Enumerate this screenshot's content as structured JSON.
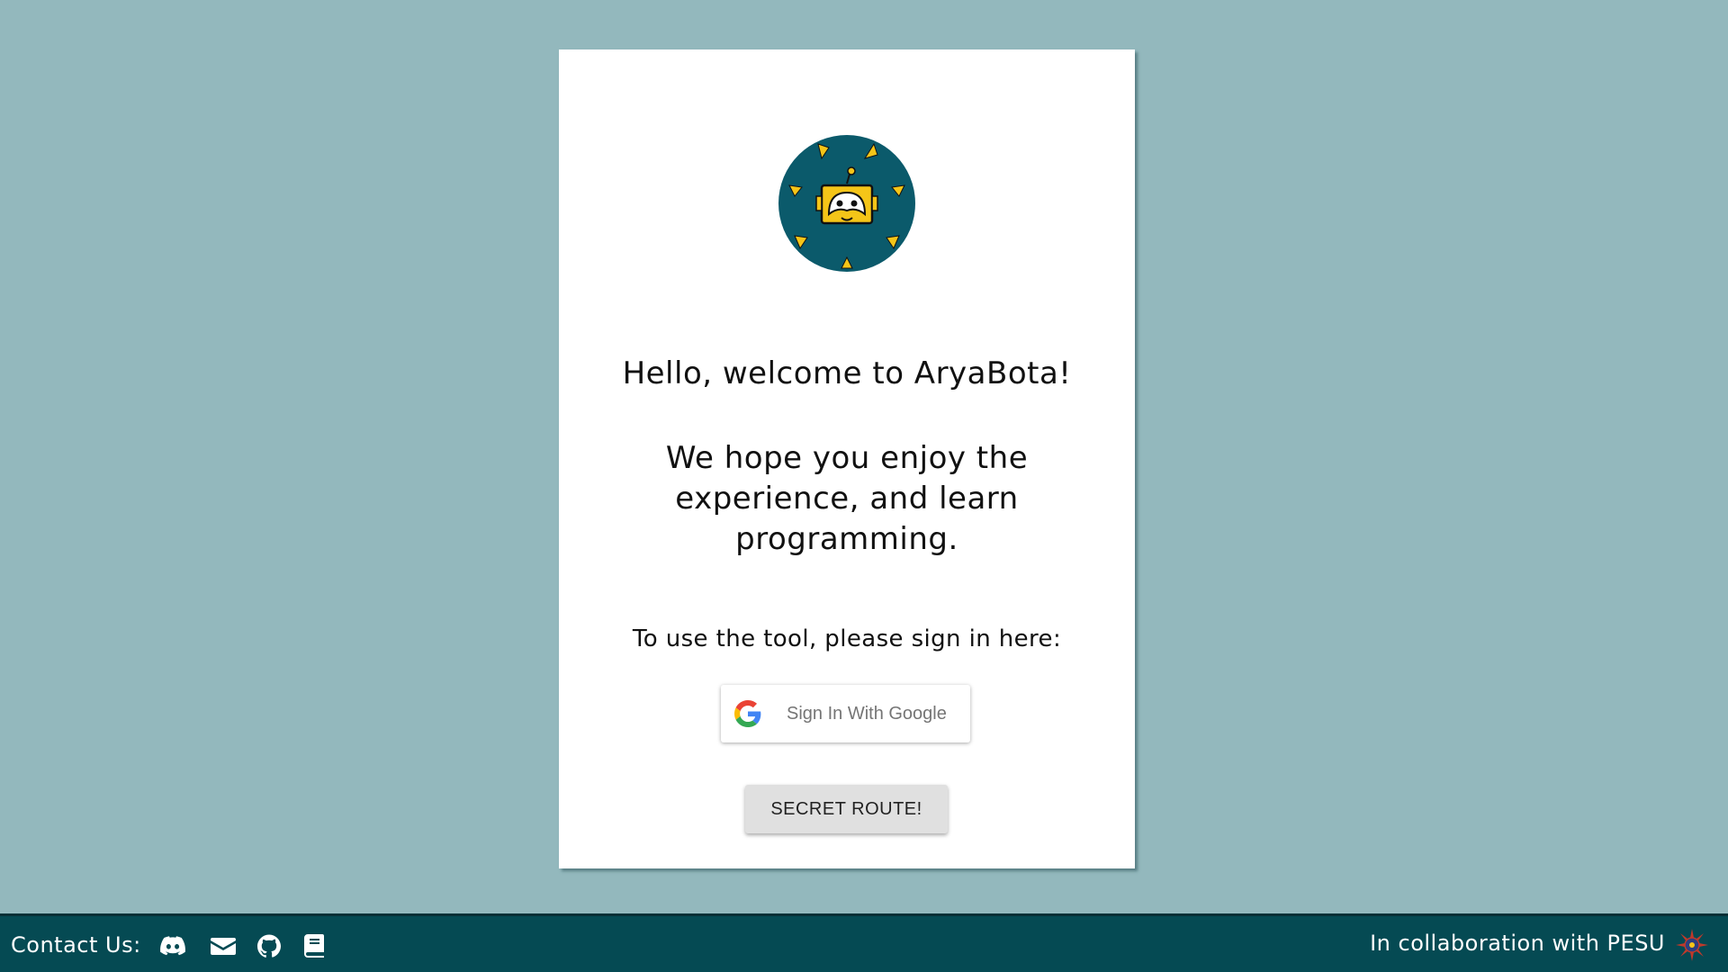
{
  "card": {
    "welcome": "Hello, welcome to AryaBota!",
    "hope": "We hope you enjoy the experience, and learn programming.",
    "signin_prompt": "To use the tool, please sign in here:",
    "google_button_label": "Sign In With Google",
    "secret_button_label": "SECRET ROUTE!"
  },
  "footer": {
    "contact_label": "Contact Us:",
    "icons": [
      "discord-icon",
      "email-icon",
      "github-icon",
      "book-icon"
    ],
    "collaboration": "In collaboration with PESU"
  },
  "colors": {
    "background": "#93b8bd",
    "footer": "#054a53",
    "logo_circle": "#0b5a6b",
    "logo_accent": "#f5c518"
  }
}
